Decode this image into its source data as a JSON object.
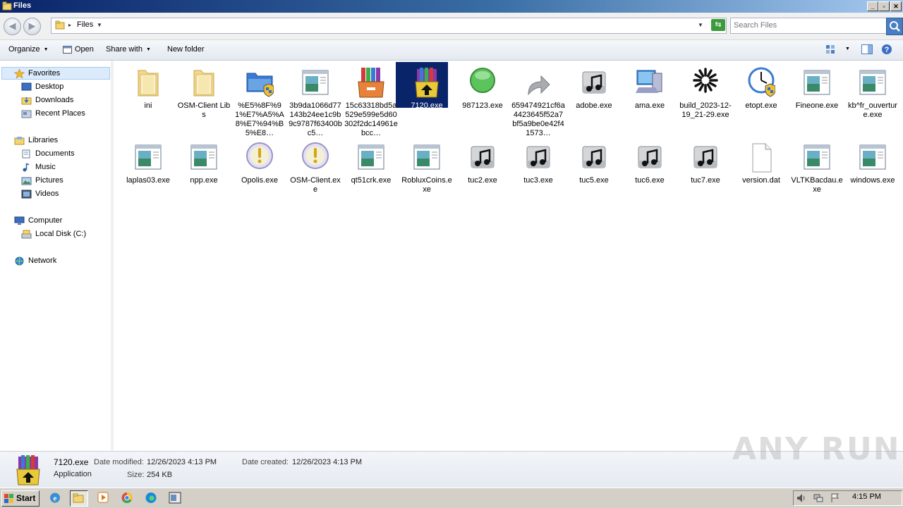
{
  "window": {
    "title": "Files",
    "controls": [
      "_",
      "▫",
      "✕"
    ]
  },
  "address": {
    "breadcrumb": "Files",
    "search_placeholder": "Search Files"
  },
  "toolbar": {
    "organize": "Organize",
    "open": "Open",
    "share_with": "Share with",
    "new_folder": "New folder"
  },
  "nav": {
    "favorites": "Favorites",
    "desktop": "Desktop",
    "downloads": "Downloads",
    "recent_places": "Recent Places",
    "libraries": "Libraries",
    "documents": "Documents",
    "music": "Music",
    "pictures": "Pictures",
    "videos": "Videos",
    "computer": "Computer",
    "local_disk": "Local Disk (C:)",
    "network": "Network"
  },
  "files": [
    {
      "name": "ini",
      "icon": "folder-icon"
    },
    {
      "name": "OSM-Client Libs",
      "icon": "folder-icon"
    },
    {
      "name": "%E5%8F%91%E7%A5%A8%E7%94%B5%E8…",
      "icon": "folder-shield-icon"
    },
    {
      "name": "3b9da1066d77143b24ee1c9b9c9787f63400bc5…",
      "icon": "app-window-icon"
    },
    {
      "name": "15c63318bd5a529e599e5d60302f2dc14961ebcc…",
      "icon": "winrar-icon"
    },
    {
      "name": "7120.exe",
      "icon": "winrar-installer-icon",
      "selected": true
    },
    {
      "name": "987123.exe",
      "icon": "green-circle-icon"
    },
    {
      "name": "659474921cf6a4423645f52a7bf5a9be0e42f41573…",
      "icon": "arrow-icon"
    },
    {
      "name": "adobe.exe",
      "icon": "music-drive-icon"
    },
    {
      "name": "ama.exe",
      "icon": "computer-icon"
    },
    {
      "name": "build_2023-12-19_21-29.exe",
      "icon": "spinner-icon"
    },
    {
      "name": "etopt.exe",
      "icon": "clock-shield-icon"
    },
    {
      "name": "Fineone.exe",
      "icon": "app-window-icon"
    },
    {
      "name": "kb^fr_ouverture.exe",
      "icon": "app-window-icon"
    },
    {
      "name": "laplas03.exe",
      "icon": "app-window-icon"
    },
    {
      "name": "npp.exe",
      "icon": "app-window-icon"
    },
    {
      "name": "Opolis.exe",
      "icon": "warning-disc-icon"
    },
    {
      "name": "OSM-Client.exe",
      "icon": "warning-disc-icon"
    },
    {
      "name": "qt51crk.exe",
      "icon": "app-window-icon"
    },
    {
      "name": "RobluxCoins.exe",
      "icon": "app-window-icon"
    },
    {
      "name": "tuc2.exe",
      "icon": "music-drive-icon"
    },
    {
      "name": "tuc3.exe",
      "icon": "music-drive-icon"
    },
    {
      "name": "tuc5.exe",
      "icon": "music-drive-icon"
    },
    {
      "name": "tuc6.exe",
      "icon": "music-drive-icon"
    },
    {
      "name": "tuc7.exe",
      "icon": "music-drive-icon"
    },
    {
      "name": "version.dat",
      "icon": "blank-file-icon"
    },
    {
      "name": "VLTKBacdau.exe",
      "icon": "app-window-icon"
    },
    {
      "name": "windows.exe",
      "icon": "app-window-icon"
    }
  ],
  "details": {
    "name": "7120.exe",
    "type": "Application",
    "modified_label": "Date modified:",
    "modified_value": "12/26/2023 4:13 PM",
    "size_label": "Size:",
    "size_value": "254 KB",
    "created_label": "Date created:",
    "created_value": "12/26/2023 4:13 PM"
  },
  "watermark": "ANY RUN",
  "taskbar": {
    "start": "Start",
    "clock": "4:15 PM"
  }
}
